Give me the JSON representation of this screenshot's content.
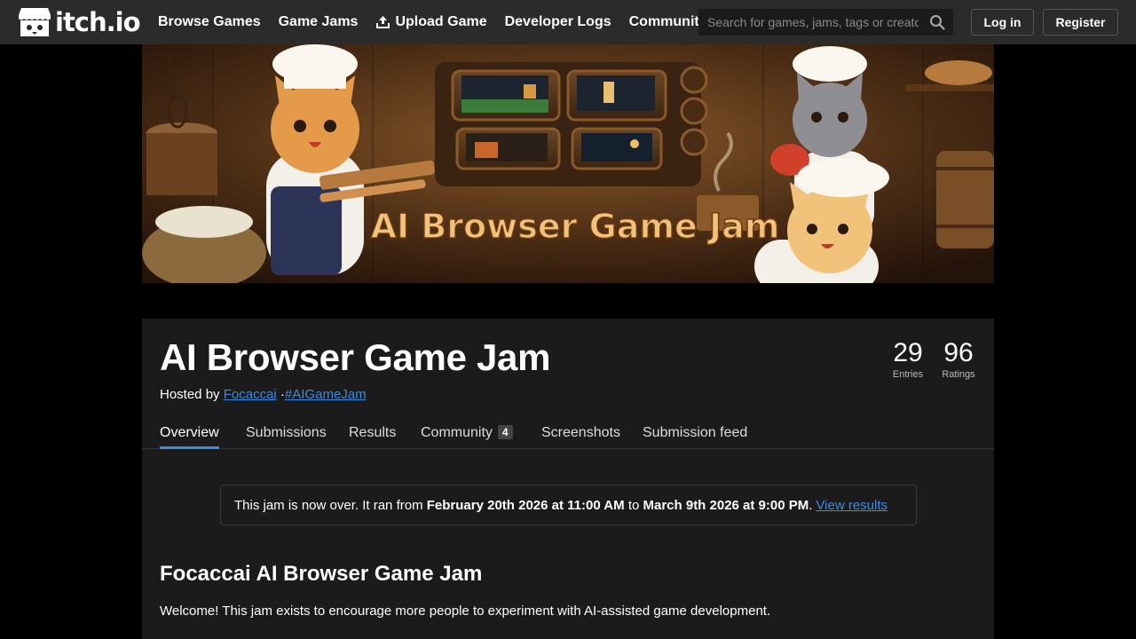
{
  "header": {
    "logo_text": "itch.io",
    "nav": [
      {
        "label": "Browse Games"
      },
      {
        "label": "Game Jams"
      },
      {
        "label": "Upload Game",
        "icon": "upload-icon"
      },
      {
        "label": "Developer Logs"
      },
      {
        "label": "Community"
      }
    ],
    "search_placeholder": "Search for games, jams, tags or creators",
    "login_label": "Log in",
    "register_label": "Register"
  },
  "banner": {
    "title": "AI Browser Game Jam"
  },
  "jam": {
    "title": "AI Browser Game Jam",
    "hosted_prefix": "Hosted by",
    "host": "Focaccai",
    "separator": "·",
    "hashtag": "#AIGameJam",
    "stats": {
      "entries_value": "29",
      "entries_label": "Entries",
      "ratings_value": "96",
      "ratings_label": "Ratings"
    },
    "tabs": [
      {
        "label": "Overview",
        "active": true
      },
      {
        "label": "Submissions"
      },
      {
        "label": "Results"
      },
      {
        "label": "Community",
        "badge": "4"
      },
      {
        "label": "Screenshots"
      },
      {
        "label": "Submission feed"
      }
    ],
    "notice": {
      "text_1": "This jam is now over. It ran from",
      "start": "February 20th 2026 at 11:00 AM",
      "text_2": "to",
      "end": "March 9th 2026 at 9:00 PM",
      "text_3": ".",
      "link": "View results"
    },
    "section_title": "Focaccai AI Browser Game Jam",
    "section_text": "Welcome! This jam exists to encourage more people to experiment with AI-assisted game development."
  },
  "colors": {
    "header_bg": "#2b2b2b",
    "panel_bg": "#1b1b1b",
    "link": "#3d8be0",
    "banner_title": "#f2c27a"
  }
}
